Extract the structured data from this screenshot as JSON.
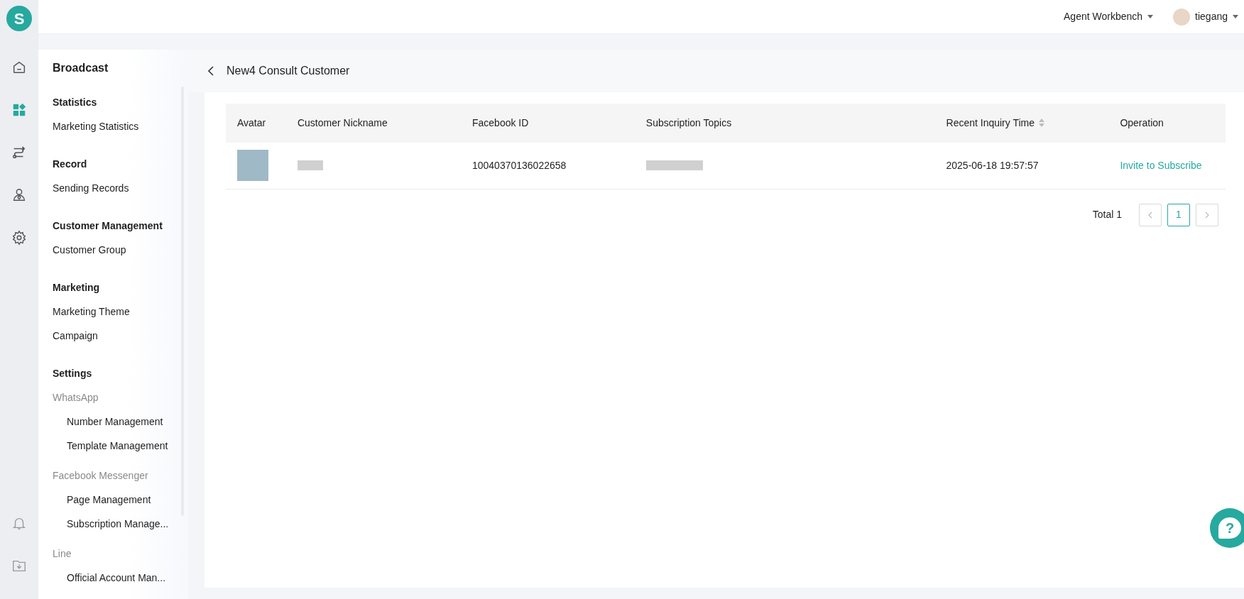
{
  "app": {
    "logo": "S"
  },
  "rail": [
    {
      "kind": "home",
      "selected": false
    },
    {
      "kind": "apps",
      "selected": true
    },
    {
      "kind": "route",
      "selected": false
    },
    {
      "kind": "person",
      "selected": false
    },
    {
      "kind": "settings",
      "selected": false
    }
  ],
  "rail_bottom": [
    {
      "kind": "bell"
    },
    {
      "kind": "download"
    }
  ],
  "topbar": {
    "workspace": "Agent Workbench",
    "user": "tiegang"
  },
  "sidebar": {
    "title": "Broadcast",
    "sections": [
      {
        "title": "Statistics",
        "items": [
          {
            "label": "Marketing Statistics"
          }
        ]
      },
      {
        "title": "Record",
        "items": [
          {
            "label": "Sending Records"
          }
        ]
      },
      {
        "title": "Customer Management",
        "items": [
          {
            "label": "Customer Group"
          }
        ]
      },
      {
        "title": "Marketing",
        "items": [
          {
            "label": "Marketing Theme"
          },
          {
            "label": "Campaign"
          }
        ]
      },
      {
        "title": "Settings",
        "items": [
          {
            "label": "WhatsApp",
            "children": [
              {
                "label": "Number Management"
              },
              {
                "label": "Template Management"
              }
            ]
          },
          {
            "label": "Facebook Messenger",
            "children": [
              {
                "label": "Page Management"
              },
              {
                "label": "Subscription Manage..."
              }
            ]
          },
          {
            "label": "Line",
            "children": [
              {
                "label": "Official Account Man..."
              }
            ]
          }
        ]
      }
    ]
  },
  "page": {
    "title": "New4 Consult Customer"
  },
  "table": {
    "columns": [
      {
        "label": "Avatar",
        "sortable": false
      },
      {
        "label": "Customer Nickname",
        "sortable": false
      },
      {
        "label": "Facebook ID",
        "sortable": false
      },
      {
        "label": "Subscription Topics",
        "sortable": false
      },
      {
        "label": "Recent Inquiry Time",
        "sortable": true
      },
      {
        "label": "Operation",
        "sortable": false
      }
    ],
    "rows": [
      {
        "facebook_id": "10040370136022658",
        "recent_inquiry_time": "2025-06-18 19:57:57",
        "operation": "Invite to Subscribe"
      }
    ]
  },
  "pagination": {
    "total": "Total 1",
    "pages": [
      {
        "label": "1",
        "selected": true
      }
    ]
  },
  "help_button": {
    "label": "?"
  }
}
